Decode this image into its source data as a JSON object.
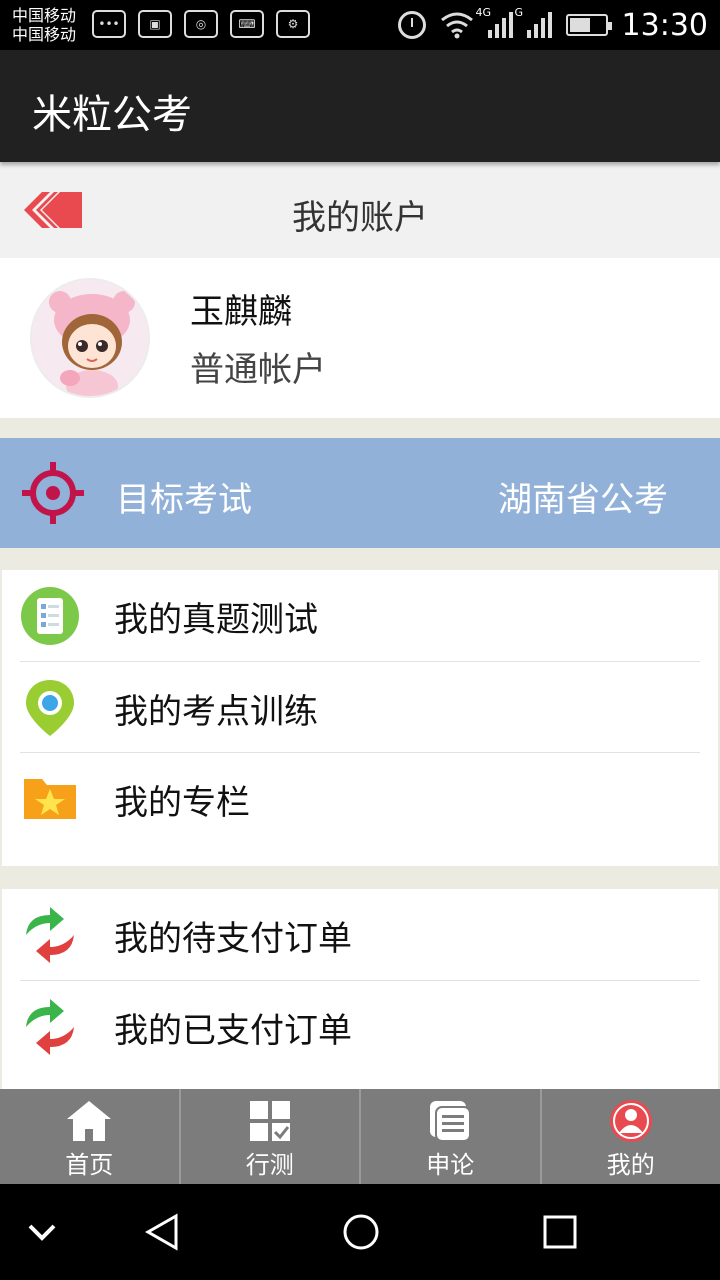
{
  "status_bar": {
    "carrier_1": "中国移动",
    "carrier_2": "中国移动",
    "network_1": "4G",
    "network_2": "G",
    "time": "13:30"
  },
  "app_bar": {
    "title": "米粒公考"
  },
  "page_header": {
    "title": "我的账户",
    "back_icon": "double-chevron-left-icon"
  },
  "profile": {
    "username": "玉麒麟",
    "account_type": "普通帐户"
  },
  "target_exam": {
    "label": "目标考试",
    "value": "湖南省公考",
    "icon": "crosshair-icon"
  },
  "menu_group_1": [
    {
      "label": "我的真题测试",
      "icon": "checklist-icon"
    },
    {
      "label": "我的考点训练",
      "icon": "location-pin-icon"
    },
    {
      "label": "我的专栏",
      "icon": "star-folder-icon"
    }
  ],
  "menu_group_2": [
    {
      "label": "我的待支付订单",
      "icon": "exchange-arrows-icon"
    },
    {
      "label": "我的已支付订单",
      "icon": "exchange-arrows-icon"
    }
  ],
  "bottom_nav": [
    {
      "label": "首页",
      "icon": "home-icon"
    },
    {
      "label": "行测",
      "icon": "grid-check-icon"
    },
    {
      "label": "申论",
      "icon": "document-icon"
    },
    {
      "label": "我的",
      "icon": "user-icon",
      "active": true
    }
  ],
  "colors": {
    "app_bar": "#212121",
    "target_banner": "#91b1d8",
    "accent_red": "#e84a4f",
    "bottom_nav": "#7c7c7c"
  }
}
